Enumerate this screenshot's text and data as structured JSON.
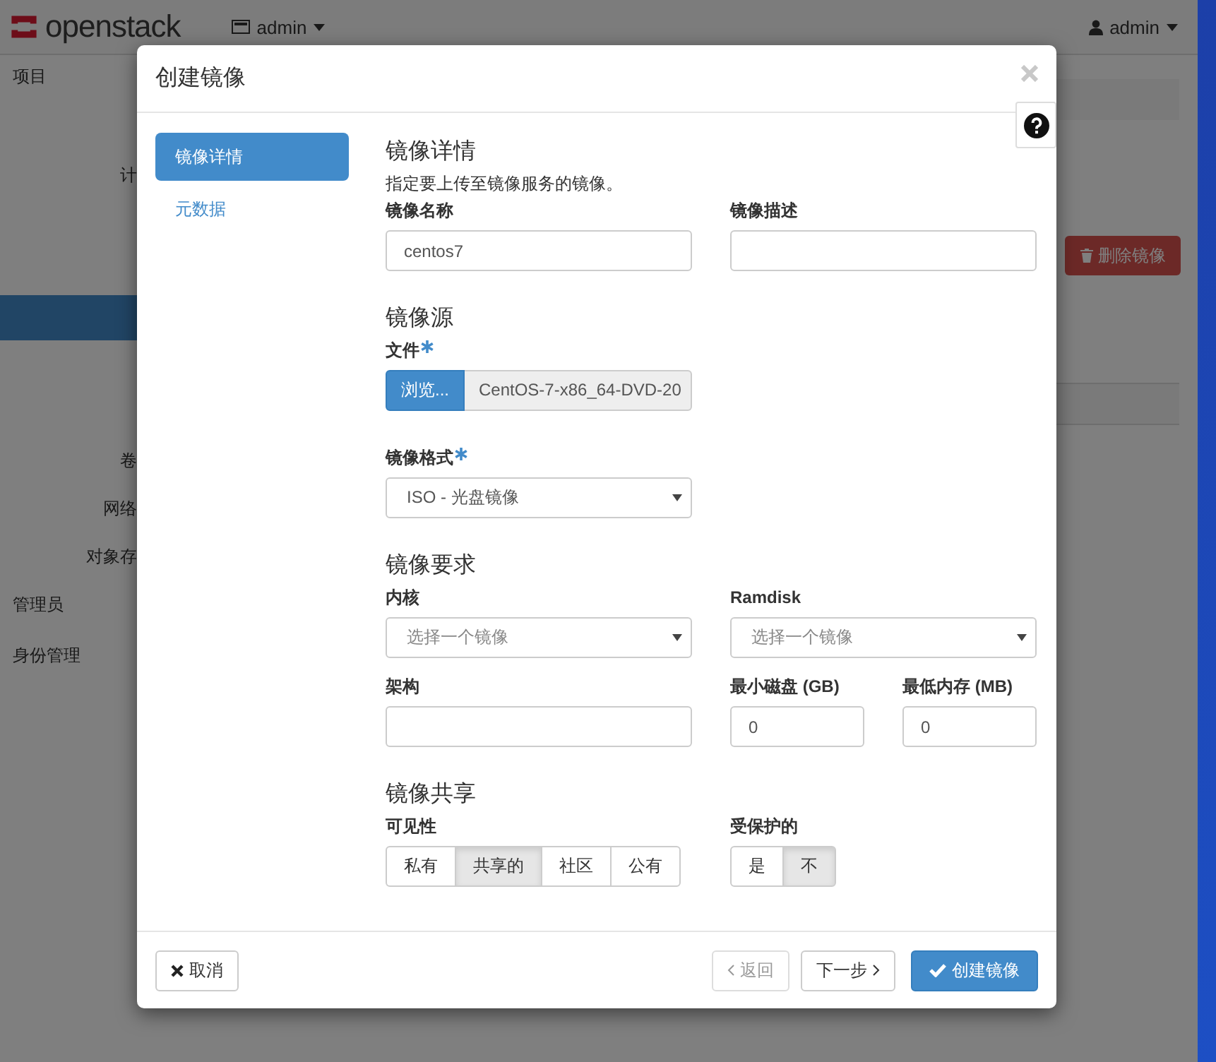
{
  "navbar": {
    "logo": "openstack",
    "project_menu": "admin",
    "user_menu": "admin"
  },
  "sidebar": {
    "items": [
      {
        "label": "项目",
        "kind": "panel"
      },
      {
        "label": "计",
        "kind": "group"
      },
      {
        "label": "卷",
        "kind": "group"
      },
      {
        "label": "网络",
        "kind": "group"
      },
      {
        "label": "对象存",
        "kind": "group"
      },
      {
        "label": "管理员",
        "kind": "panel"
      },
      {
        "label": "身份管理",
        "kind": "panel"
      }
    ]
  },
  "page": {
    "delete_button": "删除镜像"
  },
  "modal": {
    "title": "创建镜像",
    "steps": [
      {
        "label": "镜像详情",
        "selected": true
      },
      {
        "label": "元数据",
        "selected": false
      }
    ],
    "details": {
      "heading": "镜像详情",
      "description": "指定要上传至镜像服务的镜像。",
      "name": {
        "label": "镜像名称",
        "value": "centos7"
      },
      "desc": {
        "label": "镜像描述"
      }
    },
    "source": {
      "heading": "镜像源",
      "file": {
        "label": "文件",
        "required": true,
        "button": "浏览...",
        "filename": "CentOS-7-x86_64-DVD-20"
      },
      "format": {
        "label": "镜像格式",
        "required": true,
        "value": "ISO - 光盘镜像"
      }
    },
    "requirements": {
      "heading": "镜像要求",
      "kernel": {
        "label": "内核",
        "placeholder": "选择一个镜像"
      },
      "ramdisk": {
        "label": "Ramdisk",
        "placeholder": "选择一个镜像"
      },
      "arch": {
        "label": "架构"
      },
      "min_disk": {
        "label": "最小磁盘 (GB)",
        "value": "0"
      },
      "min_ram": {
        "label": "最低内存 (MB)",
        "value": "0"
      }
    },
    "sharing": {
      "heading": "镜像共享",
      "visibility": {
        "label": "可见性",
        "options": [
          {
            "label": "私有",
            "selected": false
          },
          {
            "label": "共享的",
            "selected": true
          },
          {
            "label": "社区",
            "selected": false
          },
          {
            "label": "公有",
            "selected": false
          }
        ]
      },
      "protected": {
        "label": "受保护的",
        "options": [
          {
            "label": "是",
            "selected": false
          },
          {
            "label": "不",
            "selected": true
          }
        ]
      }
    },
    "footer": {
      "cancel": "取消",
      "back": {
        "label": "返回",
        "disabled": true
      },
      "next": "下一步",
      "create": "创建镜像"
    }
  }
}
